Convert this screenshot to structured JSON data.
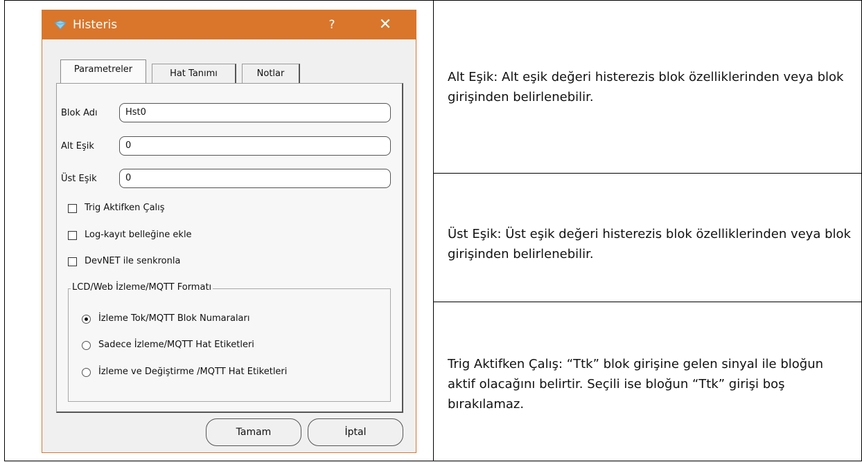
{
  "dialog": {
    "title": "Histeris",
    "help_label": "?",
    "close_label": "✕",
    "tabs": [
      {
        "label": "Parametreler",
        "active": true
      },
      {
        "label": "Hat Tanımı",
        "active": false
      },
      {
        "label": "Notlar",
        "active": false
      }
    ],
    "fields": {
      "blok_adi": {
        "label": "Blok Adı",
        "value": "Hst0"
      },
      "alt_esik": {
        "label": "Alt Eşik",
        "value": "0"
      },
      "ust_esik": {
        "label": "Üst Eşik",
        "value": "0"
      }
    },
    "checkboxes": [
      {
        "label": "Trig Aktifken Çalış",
        "checked": false
      },
      {
        "label": "Log-kayıt belleğine ekle",
        "checked": false
      },
      {
        "label": "DevNET ile senkronla",
        "checked": false
      }
    ],
    "group": {
      "title": "LCD/Web İzleme/MQTT Formatı",
      "options": [
        {
          "label": "İzleme Tok/MQTT Blok Numaraları",
          "selected": true
        },
        {
          "label": "Sadece İzleme/MQTT Hat Etiketleri",
          "selected": false
        },
        {
          "label": "İzleme ve Değiştirme /MQTT Hat Etiketleri",
          "selected": false
        }
      ]
    },
    "buttons": {
      "ok": "Tamam",
      "cancel": "İptal"
    },
    "accent_color": "#d9762b"
  },
  "descriptions": [
    {
      "text": "Alt Eşik:  Alt eşik değeri histerezis blok özelliklerinden veya blok girişinden belirlenebilir."
    },
    {
      "text": "Üst Eşik:  Üst eşik değeri histerezis blok özelliklerinden veya blok girişinden belirlenebilir."
    },
    {
      "text": "Trig Aktifken Çalış:  “Ttk” blok girişine gelen sinyal ile bloğun aktif olacağını belirtir. Seçili ise bloğun “Ttk” girişi boş bırakılamaz."
    }
  ]
}
